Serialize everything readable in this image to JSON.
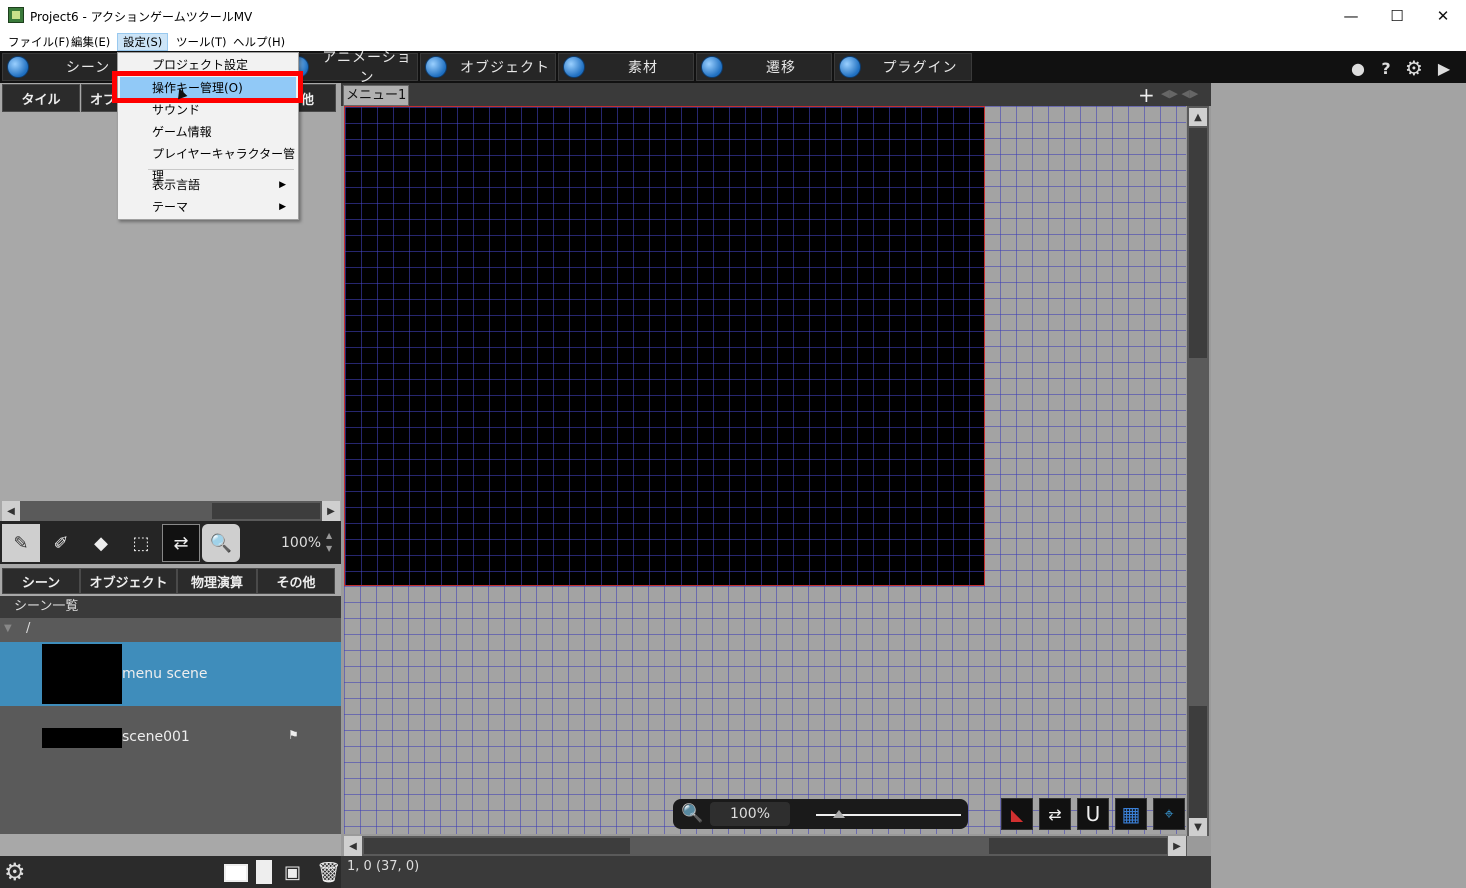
{
  "window": {
    "title": "Project6 - アクションゲームツクールMV",
    "minimize": "—",
    "maximize": "☐",
    "close": "✕"
  },
  "menubar": {
    "items": [
      {
        "label": "ファイル(F)"
      },
      {
        "label": "編集(E)"
      },
      {
        "label": "設定(S)"
      },
      {
        "label": "ツール(T)"
      },
      {
        "label": "ヘルプ(H)"
      }
    ]
  },
  "toolbar": {
    "tabs": [
      {
        "label": "シーン",
        "icon": "scene-icon"
      },
      {
        "label": "アニメーション",
        "icon": "animation-icon"
      },
      {
        "label": "オブジェクト",
        "icon": "object-icon"
      },
      {
        "label": "素材",
        "icon": "material-icon"
      },
      {
        "label": "遷移",
        "icon": "transition-icon"
      },
      {
        "label": "プラグイン",
        "icon": "plugin-icon"
      }
    ]
  },
  "settings_menu": {
    "items": [
      {
        "label": "プロジェクト設定"
      },
      {
        "label": "操作キー管理(O)"
      },
      {
        "label": "サウンド"
      },
      {
        "label": "ゲーム情報"
      },
      {
        "label": "プレイヤーキャラクター管理"
      },
      {
        "label": "表示言語"
      },
      {
        "label": "テーマ"
      }
    ],
    "highlighted_index": 1
  },
  "left_panel": {
    "top_tabs": [
      {
        "label": "タイル"
      },
      {
        "label": "オブ"
      },
      {
        "label": "他"
      }
    ],
    "zoom": "100%",
    "bottom_tabs": [
      {
        "label": "シーン"
      },
      {
        "label": "オブジェクト"
      },
      {
        "label": "物理演算"
      },
      {
        "label": "その他"
      }
    ],
    "scene_list_title": "シーン一覧",
    "root_folder": "/",
    "scenes": [
      {
        "name": "menu scene",
        "selected": true
      },
      {
        "name": "scene001",
        "selected": false
      }
    ]
  },
  "editor": {
    "tab_label": "メニュー1",
    "zoom": "100%",
    "status": "1, 0 (37, 0)"
  },
  "colors": {
    "accent_selected": "#3f8dbb",
    "highlight_box": "#ff0000",
    "menu_highlight": "#91c9f7"
  }
}
